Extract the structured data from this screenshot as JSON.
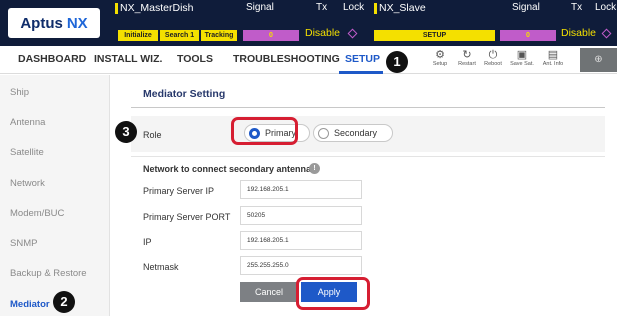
{
  "header": {
    "logo_main": "Aptus",
    "logo_accent": "NX",
    "master": {
      "name": "NX_MasterDish",
      "chips": [
        "Initialize",
        "Search 1",
        "Tracking"
      ],
      "signal_label": "Signal",
      "signal_value": "0",
      "tx_label": "Tx",
      "tx_value": "Disable",
      "lock_label": "Lock"
    },
    "slave": {
      "name": "NX_Slave",
      "status": "SETUP",
      "signal_label": "Signal",
      "signal_value": "0",
      "tx_label": "Tx",
      "tx_value": "Disable",
      "lock_label": "Lock"
    }
  },
  "nav": {
    "items": [
      "DASHBOARD",
      "INSTALL WIZ.",
      "TOOLS",
      "TROUBLESHOOTING",
      "SETUP"
    ],
    "active": "SETUP",
    "tools": [
      {
        "label": "Setup",
        "icon": "gear-icon",
        "glyph": "⚙"
      },
      {
        "label": "Restart",
        "icon": "restart-icon",
        "glyph": "↻"
      },
      {
        "label": "Reboot",
        "icon": "power-icon",
        "glyph": "⏻"
      },
      {
        "label": "Save Sat.",
        "icon": "save-icon",
        "glyph": "▣"
      },
      {
        "label": "Ant. Info",
        "icon": "antenna-info-icon",
        "glyph": "▤"
      }
    ],
    "end_glyph": "⊕"
  },
  "sidebar": {
    "items": [
      "Ship",
      "Antenna",
      "Satellite",
      "Network",
      "Modem/BUC",
      "SNMP",
      "Backup & Restore",
      "Mediator"
    ],
    "active": "Mediator"
  },
  "mediator": {
    "title": "Mediator Setting",
    "role_label": "Role",
    "role_options": [
      "Primary",
      "Secondary"
    ],
    "role_selected": "Primary",
    "network_heading": "Network to connect secondary antenna",
    "info_glyph": "!",
    "fields": [
      {
        "label": "Primary Server IP",
        "value": "192.168.205.1"
      },
      {
        "label": "Primary Server PORT",
        "value": "50205"
      },
      {
        "label": "IP",
        "value": "192.168.205.1"
      },
      {
        "label": "Netmask",
        "value": "255.255.255.0"
      }
    ],
    "cancel_label": "Cancel",
    "apply_label": "Apply"
  },
  "callouts": [
    "1",
    "2",
    "3"
  ],
  "colors": {
    "header_bg": "#0f1c3a",
    "accent_blue": "#1e59c8",
    "status_yellow": "#f4e000",
    "signal_magenta": "#c05cc9",
    "highlight_red": "#d61e32"
  }
}
